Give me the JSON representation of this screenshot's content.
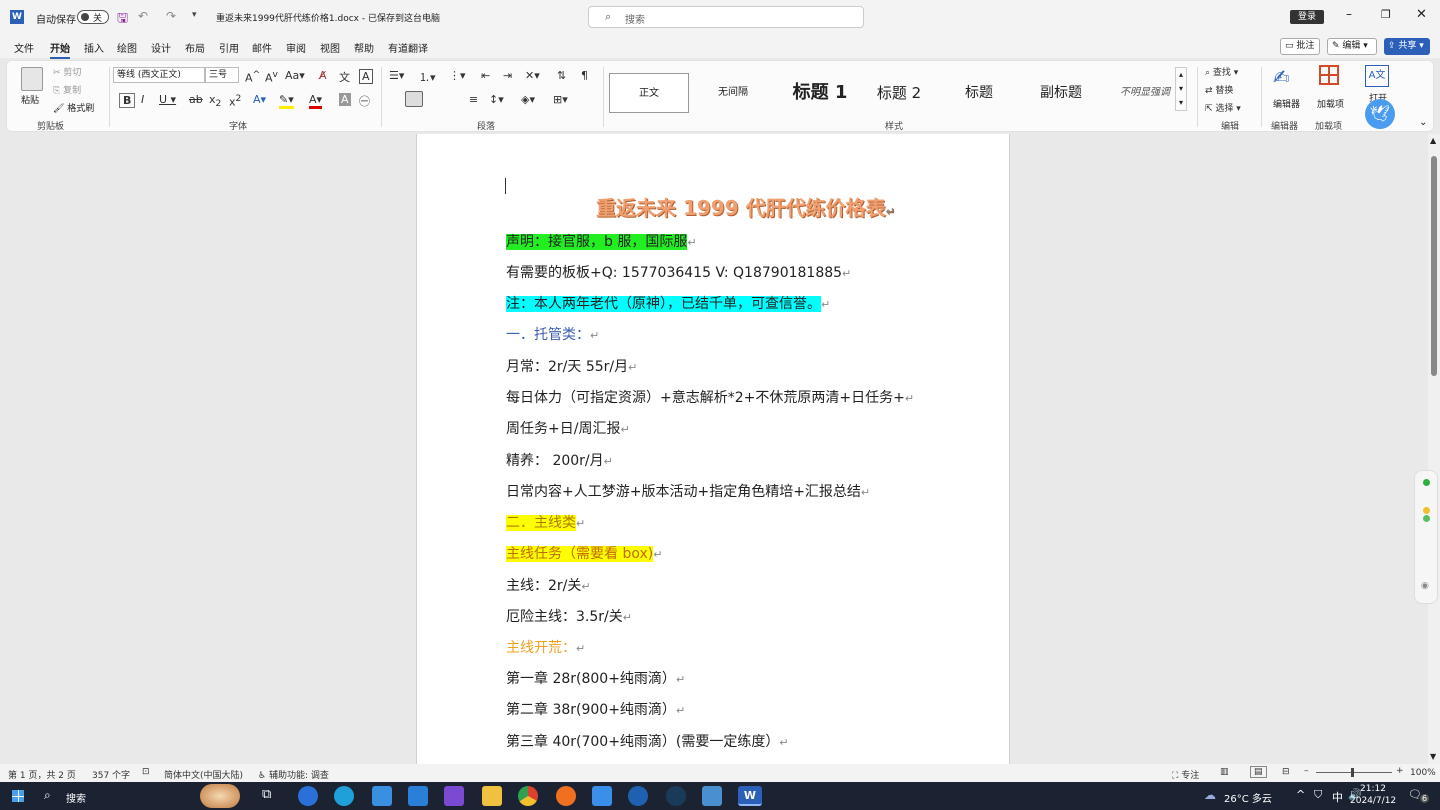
{
  "titlebar": {
    "autosave_label": "自动保存",
    "autosave_state": "关",
    "doc_title": "重返未来1999代肝代练价格1.docx - 已保存到这台电脑",
    "search_placeholder": "搜索",
    "login_label": "登录"
  },
  "menu": {
    "tabs": [
      "文件",
      "开始",
      "插入",
      "绘图",
      "设计",
      "布局",
      "引用",
      "邮件",
      "审阅",
      "视图",
      "帮助",
      "有道翻译"
    ],
    "active": "开始",
    "comment_label": "批注",
    "edit_label": "编辑",
    "share_label": "共享"
  },
  "ribbon": {
    "clipboard": {
      "paste": "粘贴",
      "cut": "剪切",
      "copy": "复制",
      "painter": "格式刷",
      "group": "剪贴板"
    },
    "font": {
      "name": "等线 (西文正文)",
      "size": "三号",
      "group": "字体"
    },
    "paragraph": {
      "group": "段落"
    },
    "styles": {
      "items": [
        "正文",
        "无间隔",
        "标题 1",
        "标题 2",
        "标题",
        "副标题",
        "不明显强调"
      ],
      "group": "样式"
    },
    "editing": {
      "find": "查找",
      "replace": "替换",
      "select": "选择",
      "group": "编辑"
    },
    "editor": {
      "label": "编辑器",
      "group": "编辑器"
    },
    "addins": {
      "label": "加载项",
      "group": "加载项"
    },
    "open": {
      "label": "打开"
    }
  },
  "document": {
    "title": "重返未来 1999 代肝代练价格表",
    "lines": [
      {
        "text": "声明：接官服，b 服，国际服",
        "hl": "#22ee22",
        "color": "#222222"
      },
      {
        "text": "有需要的板板+Q: 1577036415    V:   Q18790181885",
        "hl": "",
        "color": "#222222"
      },
      {
        "text": "注：本人两年老代（原神），已结千单，可查信誉。",
        "hl": "#00ffff",
        "color": "#222222"
      },
      {
        "text": "一．托管类：",
        "hl": "",
        "color": "#3a5fb0"
      },
      {
        "text": "月常：2r/天      55r/月",
        "hl": "",
        "color": "#222222"
      },
      {
        "text": "每日体力（可指定资源）+意志解析*2+不休荒原两清+日任务+",
        "hl": "",
        "color": "#222222"
      },
      {
        "text": "周任务+日/周汇报",
        "hl": "",
        "color": "#222222"
      },
      {
        "text": "精养：    200r/月",
        "hl": "",
        "color": "#222222"
      },
      {
        "text": "日常内容+人工梦游+版本活动+指定角色精培+汇报总结",
        "hl": "",
        "color": "#222222"
      },
      {
        "text": "二．主线类",
        "hl": "#ffff00",
        "color": "#b07a00"
      },
      {
        "text": "主线任务（需要看 box)",
        "hl": "#ffff00",
        "color": "#c06a00"
      },
      {
        "text": "主线：2r/关",
        "hl": "",
        "color": "#222222"
      },
      {
        "text": "厄险主线：3.5r/关",
        "hl": "",
        "color": "#222222"
      },
      {
        "text": "主线开荒：",
        "hl": "",
        "color": "#f0a020"
      },
      {
        "text": "第一章 28r(800+纯雨滴）",
        "hl": "",
        "color": "#222222"
      },
      {
        "text": "第二章 38r(900+纯雨滴）",
        "hl": "",
        "color": "#222222"
      },
      {
        "text": "第三章 40r(700+纯雨滴）(需要一定练度）",
        "hl": "",
        "color": "#222222"
      }
    ]
  },
  "status": {
    "page": "第 1 页，共 2 页",
    "words": "357 个字",
    "lang": "简体中文(中国大陆)",
    "access": "辅助功能: 调查",
    "focus": "专注",
    "zoom": "100%"
  },
  "taskbar": {
    "search": "搜索",
    "weather": "26°C 多云",
    "ime": "中",
    "time": "21:12",
    "date": "2024/7/12",
    "badge": "6"
  }
}
